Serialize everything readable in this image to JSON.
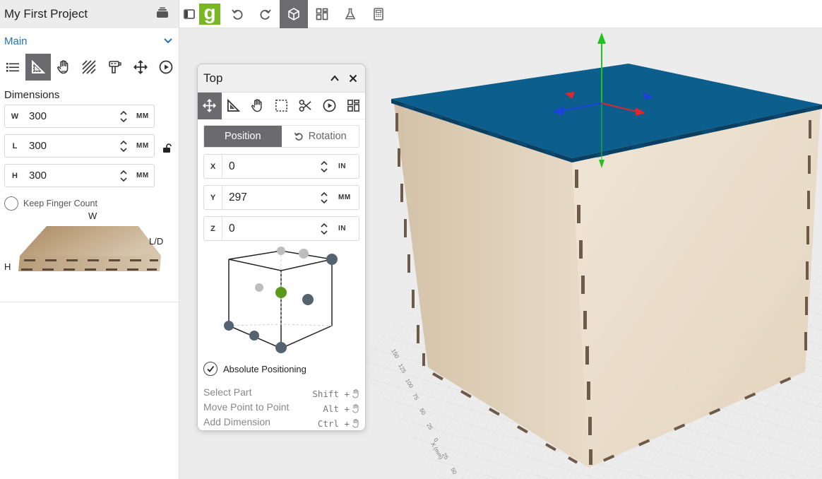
{
  "project": {
    "title": "My First Project"
  },
  "sidebar": {
    "section_select": "Main",
    "tools": [
      "list-icon",
      "ruler-triangle-icon",
      "hand-icon",
      "hatch-icon",
      "drill-icon",
      "move-icon",
      "play-icon"
    ],
    "dimensions_label": "Dimensions",
    "dims": [
      {
        "letter": "W",
        "value": "300",
        "unit": "MM"
      },
      {
        "letter": "L",
        "value": "300",
        "unit": "MM"
      },
      {
        "letter": "H",
        "value": "300",
        "unit": "MM"
      }
    ],
    "keep_finger_count": "Keep Finger Count",
    "preview": {
      "w": "W",
      "ld": "L/D",
      "h": "H"
    }
  },
  "toolbar": {
    "logo_letter": "g"
  },
  "panel": {
    "title": "Top",
    "tabs": {
      "position": "Position",
      "rotation": "Rotation"
    },
    "coords": [
      {
        "letter": "X",
        "value": "0",
        "unit": "IN"
      },
      {
        "letter": "Y",
        "value": "297",
        "unit": "MM"
      },
      {
        "letter": "Z",
        "value": "0",
        "unit": "IN"
      }
    ],
    "absolute_positioning": "Absolute Positioning",
    "hints": [
      {
        "action": "Select Part",
        "key": "Shift +"
      },
      {
        "action": "Move Point to Point",
        "key": "Alt +"
      },
      {
        "action": "Add Dimension",
        "key": "Ctrl +"
      }
    ]
  },
  "viewport": {
    "colors": {
      "top_panel": "#0c5e8c",
      "wood": "#e6d8c3",
      "gizmo_x": "#e2262b",
      "gizmo_y": "#22c322",
      "gizmo_z": "#1f3fe0"
    },
    "grid_axis_label": "X (mm)",
    "grid_ticks": [
      "150",
      "125",
      "100",
      "75",
      "50",
      "25",
      "0",
      "25",
      "50",
      "75"
    ]
  }
}
